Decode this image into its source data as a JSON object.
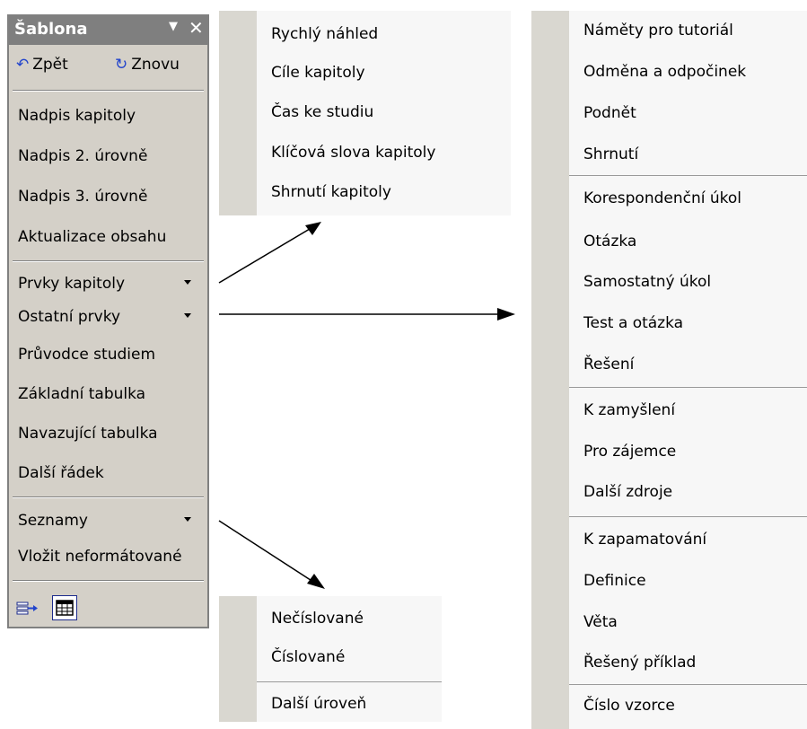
{
  "toolbar": {
    "title": "Šablona",
    "dropdown_glyph": "▼",
    "close_glyph": "✕",
    "undo_label": "Zpět",
    "redo_label": "Znovu",
    "items": [
      "Nadpis kapitoly",
      "Nadpis 2. úrovně",
      "Nadpis 3. úrovně",
      "Aktualizace obsahu",
      "Prvky kapitoly",
      "Ostatní prvky",
      "Průvodce studiem",
      "Základní tabulka",
      "Navazující tabulka",
      "Další řádek",
      "Seznamy",
      "Vložit neformátované"
    ],
    "icons": [
      "insert-arrow-icon",
      "table-grid-icon"
    ]
  },
  "menu_prvky_kapitoly": {
    "items": [
      "Rychlý náhled",
      "Cíle kapitoly",
      "Čas ke studiu",
      "Klíčová slova kapitoly",
      "Shrnutí kapitoly"
    ]
  },
  "menu_seznamy": {
    "items": [
      "Nečíslované",
      "Číslované",
      "Další úroveň"
    ]
  },
  "menu_ostatni_prvky": {
    "items": [
      "Náměty pro tutoriál",
      "Odměna a odpočinek",
      "Podnět",
      "Shrnutí",
      "Korespondenční úkol",
      "Otázka",
      "Samostatný úkol",
      "Test a otázka",
      "Řešení",
      "K zamyšlení",
      "Pro zájemce",
      "Další zdroje",
      "K zapamatování",
      "Definice",
      "Věta",
      "Řešený příklad",
      "Číslo vzorce"
    ]
  },
  "colors": {
    "toolbar_bg": "#d4d0c8",
    "titlebar_bg": "#7f7f7f",
    "menu_bg": "#f7f7f7",
    "menu_strip": "#d9d7d0",
    "accent_blue": "#2244cc"
  }
}
